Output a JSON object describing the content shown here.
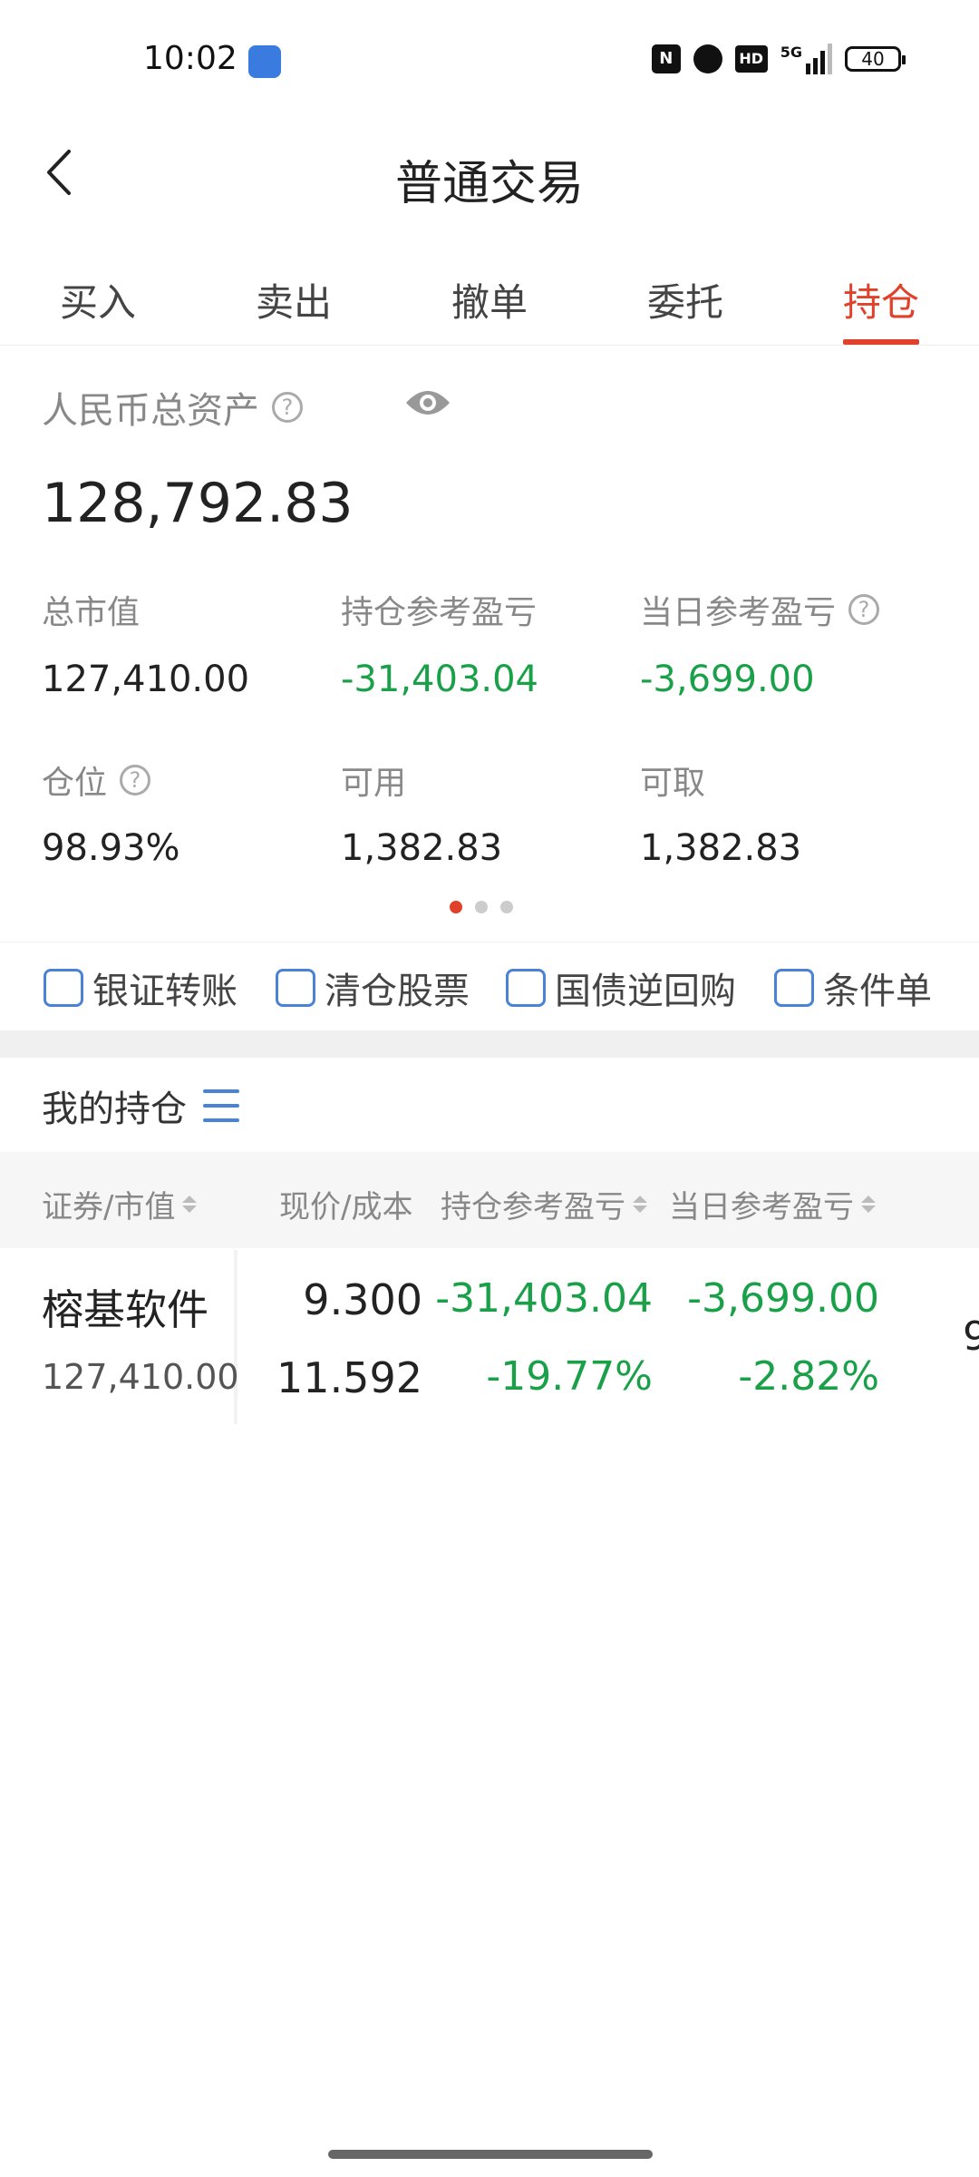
{
  "status_bar": {
    "time": "10:02",
    "network": "5G",
    "hd": "HD",
    "battery": "40"
  },
  "header": {
    "title": "普通交易"
  },
  "tabs": [
    {
      "label": "买入"
    },
    {
      "label": "卖出"
    },
    {
      "label": "撤单"
    },
    {
      "label": "委托"
    },
    {
      "label": "持仓",
      "active": true
    }
  ],
  "asset": {
    "label": "人民币总资产",
    "value": "128,792.83"
  },
  "stats": {
    "total_market_value": {
      "label": "总市值",
      "value": "127,410.00"
    },
    "position_pnl": {
      "label": "持仓参考盈亏",
      "value": "-31,403.04"
    },
    "day_pnl": {
      "label": "当日参考盈亏",
      "value": "-3,699.00"
    },
    "position_ratio": {
      "label": "仓位",
      "value": "98.93%"
    },
    "available": {
      "label": "可用",
      "value": "1,382.83"
    },
    "withdrawable": {
      "label": "可取",
      "value": "1,382.83"
    }
  },
  "quick_actions": [
    {
      "label": "银证转账"
    },
    {
      "label": "清仓股票"
    },
    {
      "label": "国债逆回购"
    },
    {
      "label": "条件单"
    }
  ],
  "holdings": {
    "title": "我的持仓",
    "columns": [
      "证券/市值",
      "现价/成本",
      "持仓参考盈亏",
      "当日参考盈亏"
    ],
    "rows": [
      {
        "name": "榕基软件",
        "market_value": "127,410.00",
        "price": "9.300",
        "cost": "11.592",
        "position_pnl": "-31,403.04",
        "position_pnl_pct": "-19.77%",
        "day_pnl": "-3,699.00",
        "day_pnl_pct": "-2.82%",
        "overflow": "9"
      }
    ]
  },
  "colors": {
    "accent": "#e0412a",
    "loss": "#1aa048",
    "icon_blue": "#4a83d6"
  }
}
